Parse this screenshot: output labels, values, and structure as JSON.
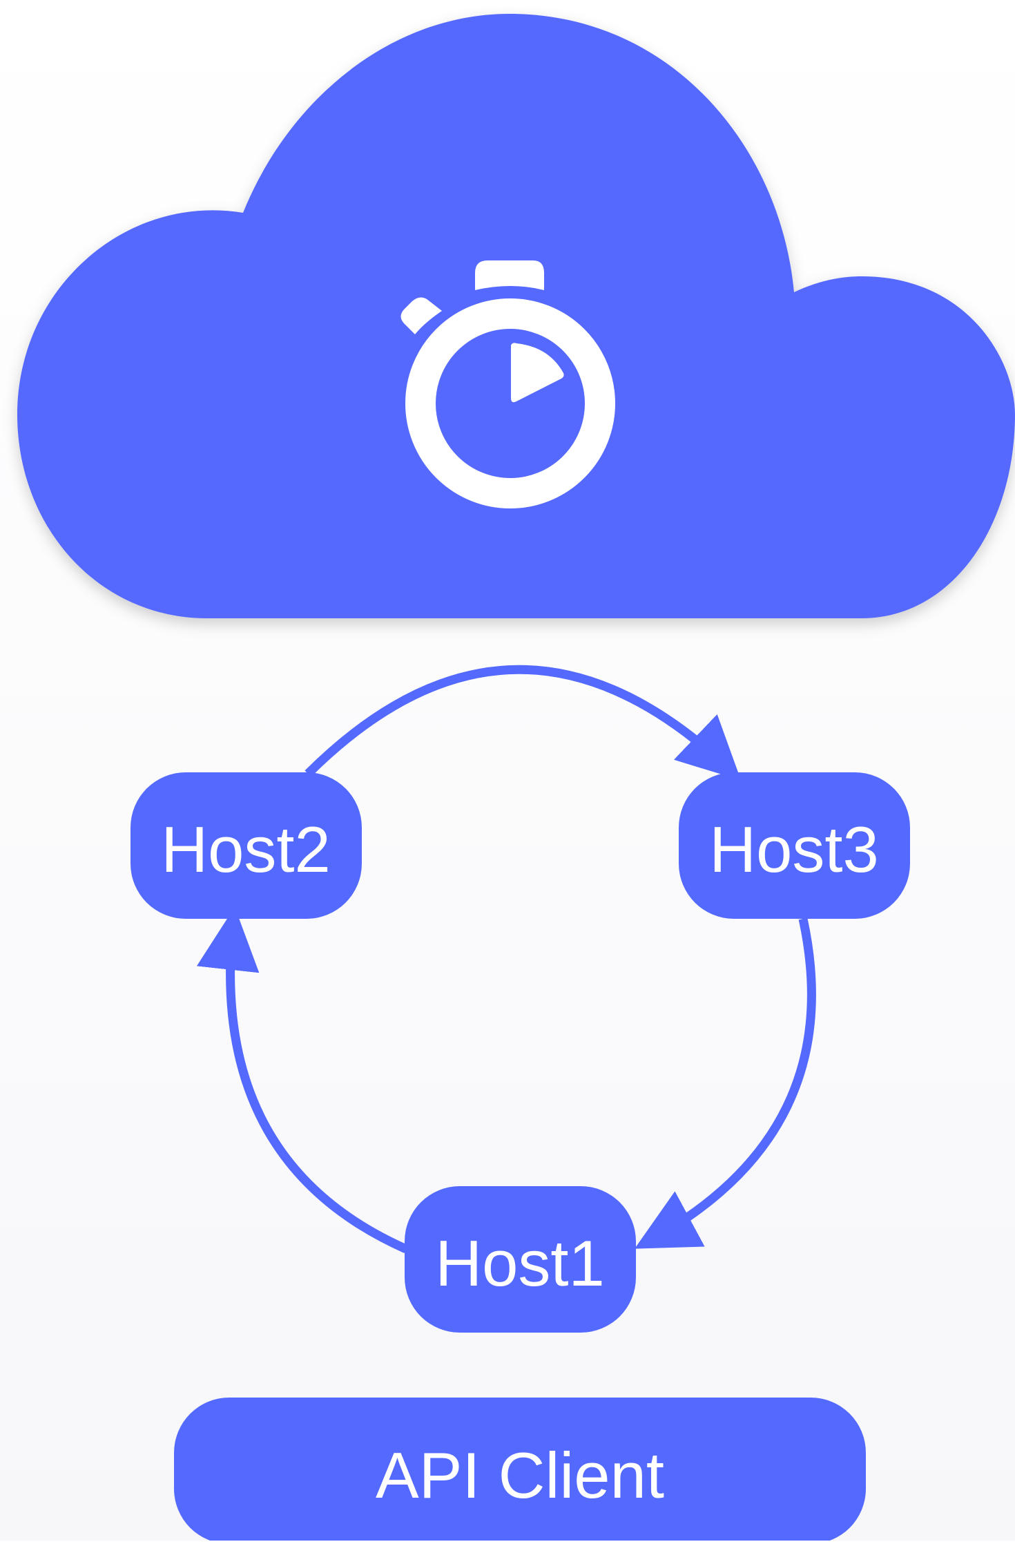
{
  "colors": {
    "brand": "#5469fe",
    "label_text": "#ffffff",
    "icon": "#ffffff",
    "background": "#f7f7fa"
  },
  "cloud": {
    "icon": "stopwatch-icon"
  },
  "ring": {
    "hosts": [
      {
        "label": "Host2"
      },
      {
        "label": "Host3"
      },
      {
        "label": "Host1"
      }
    ],
    "connections": [
      {
        "from": "Host2",
        "to": "Host3"
      },
      {
        "from": "Host3",
        "to": "Host1"
      },
      {
        "from": "Host1",
        "to": "Host2"
      }
    ]
  },
  "client": {
    "label": "API Client"
  }
}
